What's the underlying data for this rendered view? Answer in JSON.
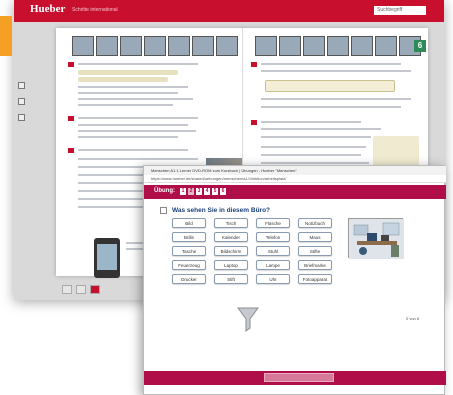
{
  "ebook": {
    "brand": "Hueber",
    "brand_sub": "Schritte international",
    "search_placeholder": "Suchbegriff",
    "page_number": "6"
  },
  "exercise": {
    "window_title": "Menschen A1.1 Lerner DVD-ROM zum Kursbuch | Übungen - Hueber \"Menschen\"",
    "url": "https://www.hueber.de/shared/uebungen/menschen/a1/1/lektion/arbeitsplatz/",
    "header_label": "Übung:",
    "nav_items": [
      "1",
      "2",
      "3",
      "4",
      "5",
      "6"
    ],
    "question": "Was sehen Sie in diesem Büro?",
    "words": [
      [
        "Bild",
        "Tisch",
        "Flasche",
        "Notizbuch"
      ],
      [
        "Brille",
        "Kalender",
        "Telefon",
        "Maus"
      ],
      [
        "Tasche",
        "Bildschirm",
        "Stuhl",
        "Stifte"
      ],
      [
        "Feuerzeug",
        "Laptop",
        "Lampe",
        "Briefmarke"
      ],
      [
        "Drucker",
        "Stift",
        "Uhr",
        "Fotoapparat"
      ]
    ],
    "status": "0 von 8"
  },
  "colors": {
    "hueber_red": "#c8102e",
    "exercise_magenta": "#b00e48",
    "accent_orange": "#f5a024"
  }
}
